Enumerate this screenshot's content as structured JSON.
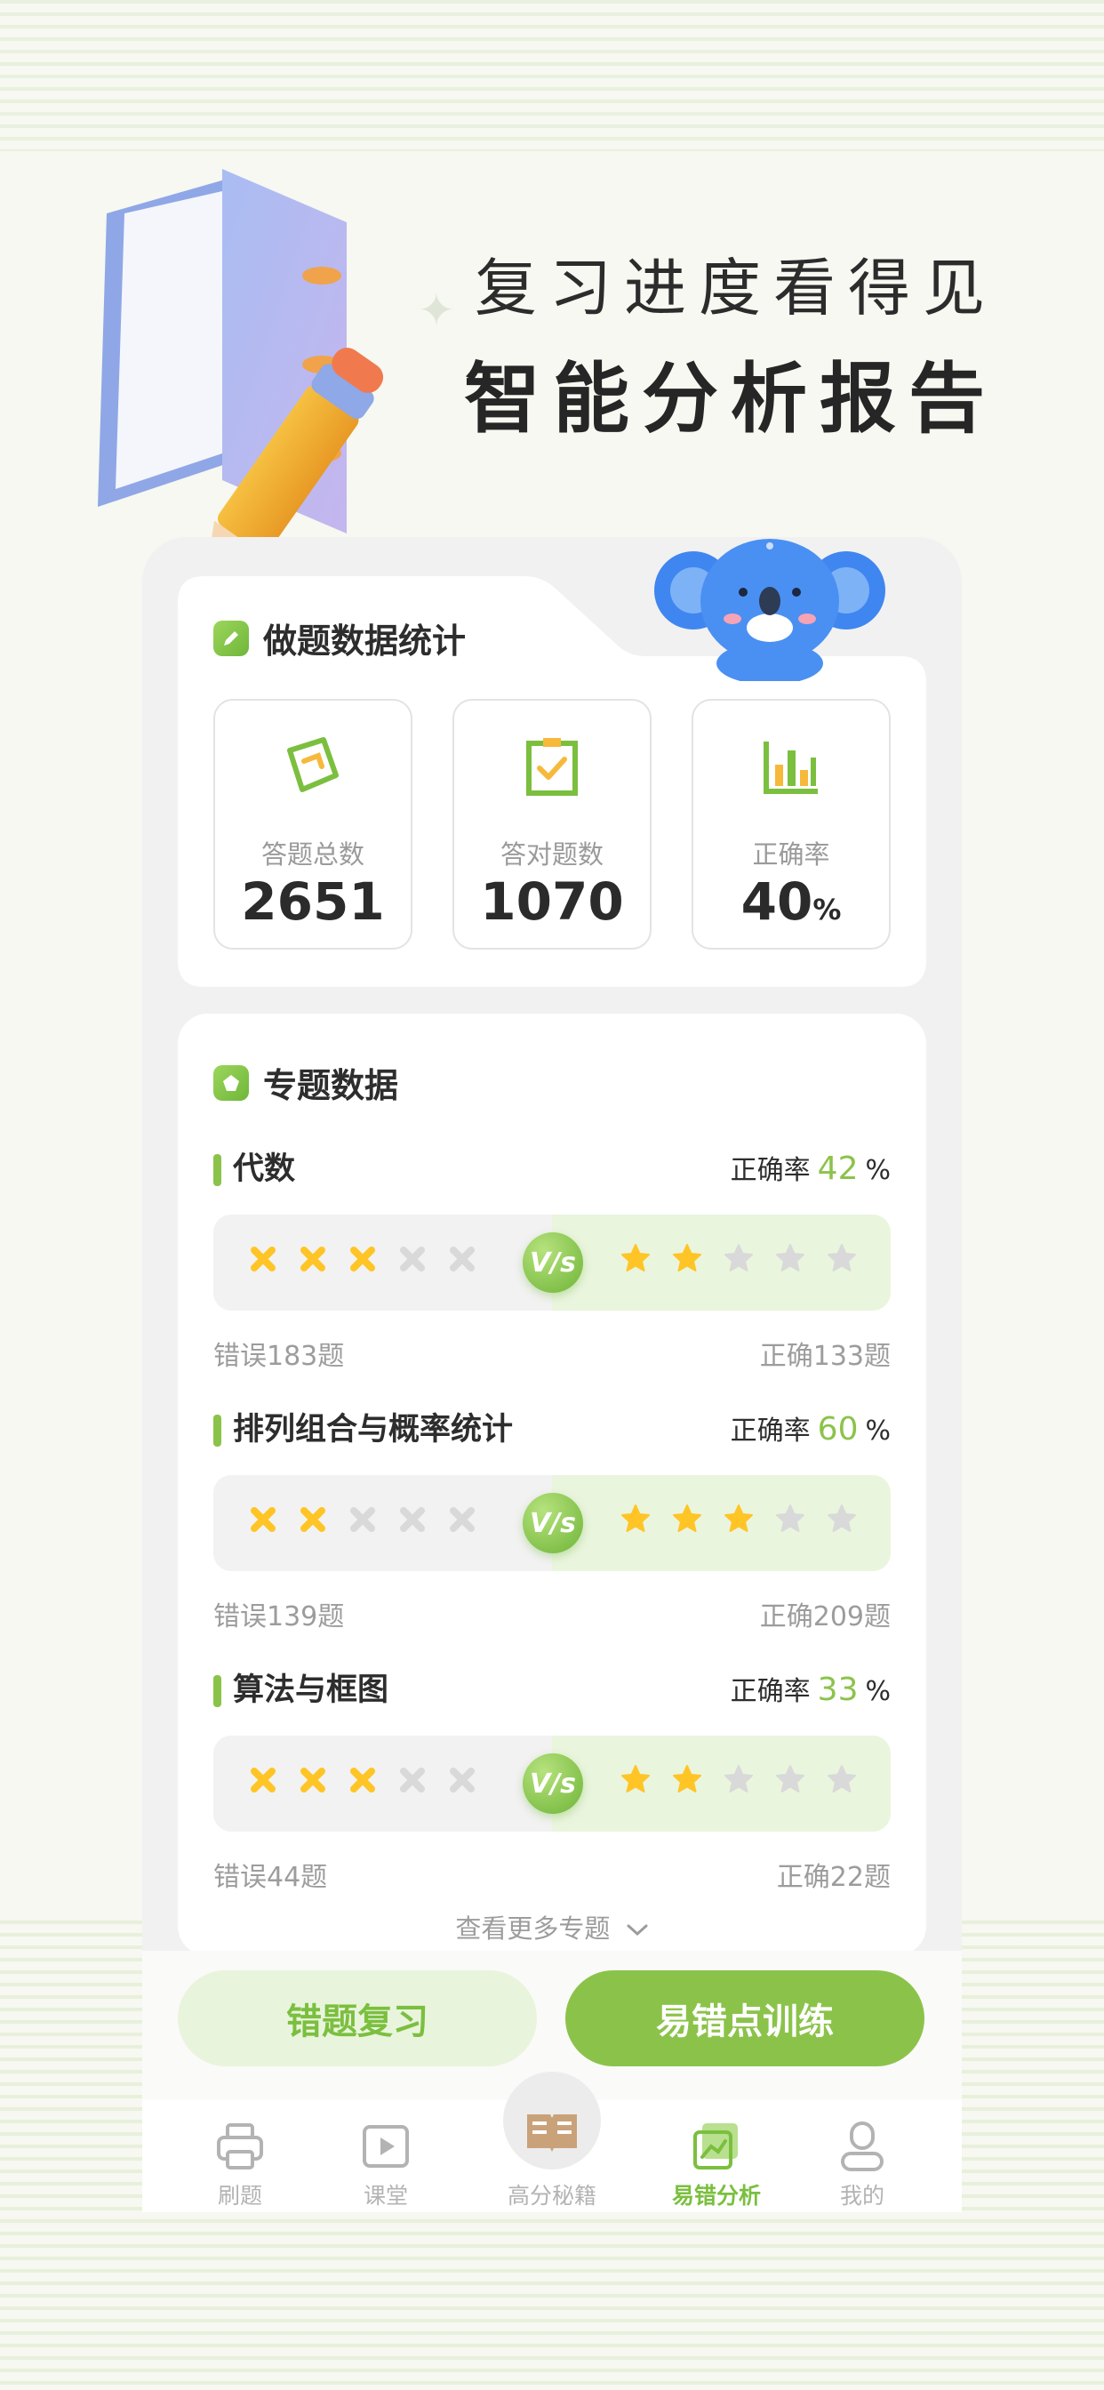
{
  "hero": {
    "subtitle": "复习进度看得见",
    "title": "智能分析报告"
  },
  "stats": {
    "title": "做题数据统计",
    "items": [
      {
        "label": "答题总数",
        "value": "2651",
        "icon": "answer-sheet-icon"
      },
      {
        "label": "答对题数",
        "value": "1070",
        "icon": "clipboard-check-icon"
      },
      {
        "label": "正确率",
        "value": "40",
        "unit": "%",
        "icon": "bar-chart-icon"
      }
    ]
  },
  "topics": {
    "title": "专题数据",
    "rate_label": "正确率",
    "percent_sign": "%",
    "vs_label": "V/s",
    "items": [
      {
        "name": "代数",
        "rate": "42",
        "wrong": "错误183题",
        "right": "正确133题",
        "wrong_marks": 3,
        "right_stars": 2
      },
      {
        "name": "排列组合与概率统计",
        "rate": "60",
        "wrong": "错误139题",
        "right": "正确209题",
        "wrong_marks": 2,
        "right_stars": 3
      },
      {
        "name": "算法与框图",
        "rate": "33",
        "wrong": "错误44题",
        "right": "正确22题",
        "wrong_marks": 3,
        "right_stars": 2
      }
    ],
    "more": "查看更多专题"
  },
  "actions": {
    "review": "错题复习",
    "train": "易错点训练"
  },
  "tabbar": {
    "items": [
      {
        "label": "刷题",
        "icon": "printer-icon"
      },
      {
        "label": "课堂",
        "icon": "play-video-icon"
      },
      {
        "label": "高分秘籍",
        "icon": "open-book-icon"
      },
      {
        "label": "易错分析",
        "icon": "trend-chart-icon",
        "active": true
      },
      {
        "label": "我的",
        "icon": "person-icon"
      }
    ]
  },
  "colors": {
    "accent": "#8bc34a",
    "accent_light": "#e9f4dc",
    "mark_yellow": "#ffc526",
    "mark_grey": "#d9d9d9"
  }
}
